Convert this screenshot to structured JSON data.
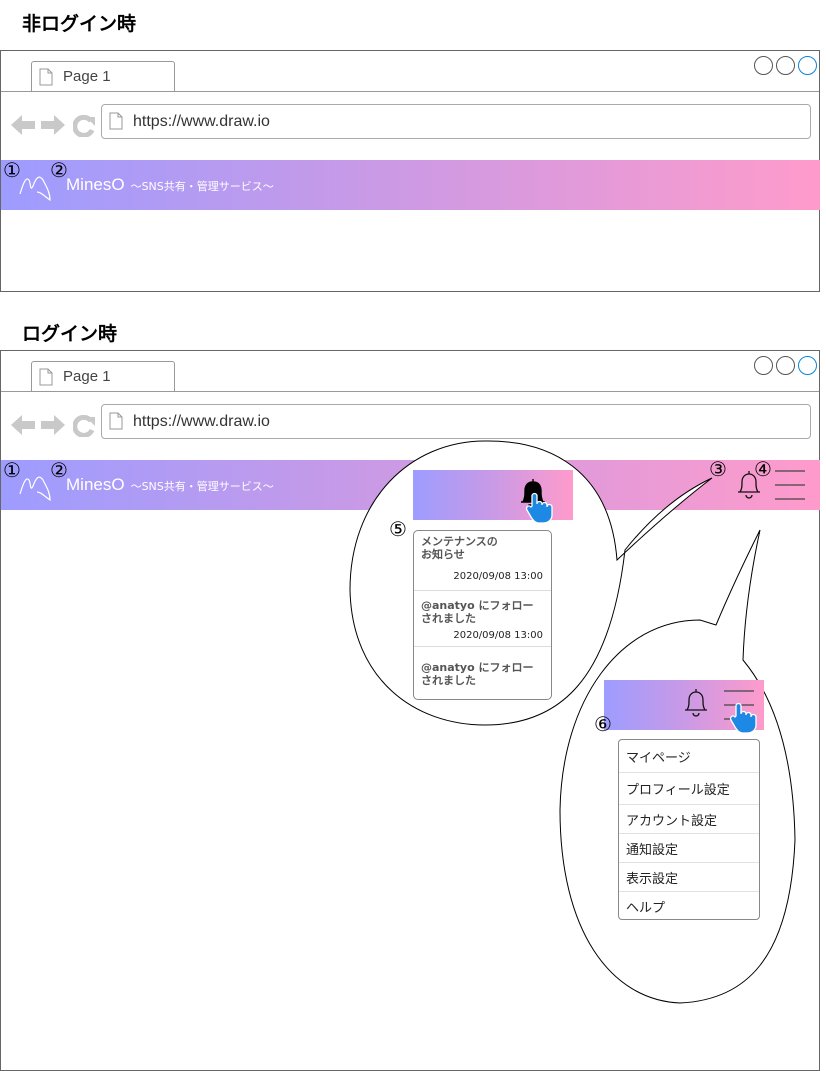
{
  "sections": {
    "logged_out_title": "非ログイン時",
    "logged_in_title": "ログイン時"
  },
  "browser": {
    "tab_label": "Page 1",
    "url": "https://www.draw.io"
  },
  "header": {
    "brand_name": "MinesO",
    "tagline": "～SNS共有・管理サービス～"
  },
  "markers": [
    "①",
    "②",
    "③",
    "④",
    "⑤",
    "⑥"
  ],
  "notifications": {
    "items": [
      {
        "text": "メンテナンスの\nお知らせ",
        "time": "2020/09/08 13:00"
      },
      {
        "text": "@anatyo にフォロー\nされました",
        "time": "2020/09/08 13:00"
      },
      {
        "text": "@anatyo にフォロー\nされました",
        "time": ""
      }
    ]
  },
  "user_menu": {
    "items": [
      "マイページ",
      "プロフィール設定",
      "アカウント設定",
      "通知設定",
      "表示設定",
      "ヘルプ"
    ]
  },
  "colors": {
    "header_gradient_start": "#9d9cff",
    "header_gradient_end": "#ff9bcb",
    "pointer_hand": "#1e88e5"
  },
  "icons": [
    "page-icon",
    "back-arrow-icon",
    "forward-arrow-icon",
    "reload-icon",
    "logo-icon",
    "bell-icon",
    "hamburger-menu-icon",
    "pointer-hand-icon"
  ]
}
